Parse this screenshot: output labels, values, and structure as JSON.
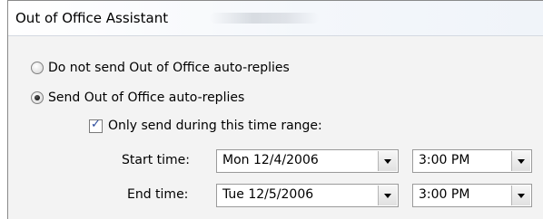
{
  "dialog": {
    "title": "Out of Office Assistant"
  },
  "options": {
    "do_not_send_label": "Do not send Out of Office auto-replies",
    "send_label": "Send Out of Office auto-replies",
    "selected": "send"
  },
  "time_range": {
    "checkbox_label": "Only send during this time range:",
    "checked": true,
    "start_label": "Start time:",
    "start_date": "Mon 12/4/2006",
    "start_time": "3:00 PM",
    "end_label": "End time:",
    "end_date": "Tue 12/5/2006",
    "end_time": "3:00 PM"
  },
  "icons": {
    "checkbox_check": "✓",
    "dropdown": "chevron-down-icon"
  }
}
